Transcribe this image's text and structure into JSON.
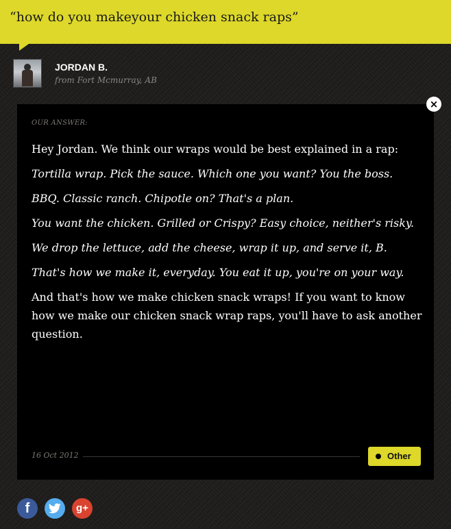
{
  "question": {
    "text": "“how do you makeyour chicken snack raps”"
  },
  "user": {
    "name": "JORDAN B.",
    "location": "from Fort Mcmurray, AB"
  },
  "answer": {
    "label": "OUR ANSWER:",
    "paragraphs": [
      "Hey Jordan.  We think our wraps would be best explained in a rap:",
      "Tortilla wrap. Pick the sauce. Which one you want? You the boss.",
      "BBQ. Classic ranch. Chipotle on? That's a plan.",
      "You want the chicken. Grilled or Crispy? Easy choice, neither's risky.",
      "We drop the lettuce, add the cheese,  wrap it up, and serve it, B.",
      "That's how we make it, everyday. You eat it up, you're on your way.",
      "And that's how we make chicken snack wraps! If you want to know how we make our chicken snack wrap raps, you'll have to ask another question."
    ],
    "date": "16 Oct 2012",
    "category": "Other"
  },
  "icons": {
    "close": "close-icon",
    "facebook": "facebook-icon",
    "twitter": "twitter-icon",
    "googleplus": "googleplus-icon",
    "facebook_glyph": "f",
    "googleplus_glyph": "g+",
    "close_glyph": "×"
  },
  "colors": {
    "accent": "#ddd82a",
    "background": "#1d1c1a",
    "panel": "#000000",
    "facebook": "#3b5a9a",
    "twitter": "#55acee",
    "googleplus": "#d9432f"
  }
}
